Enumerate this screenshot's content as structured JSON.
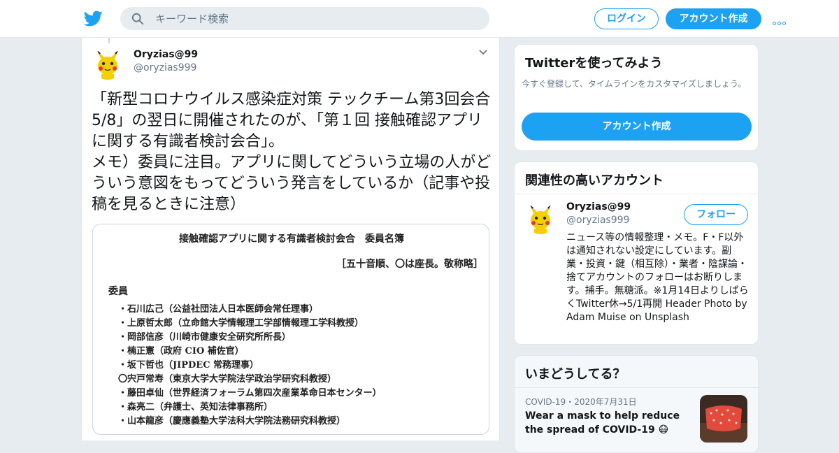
{
  "header": {
    "search_placeholder": "キーワード検索",
    "login_label": "ログイン",
    "signup_label": "アカウント作成",
    "brand_color": "#1da1f2"
  },
  "tweet": {
    "author_name": "Oryzias@99",
    "author_handle": "@oryzias999",
    "text": "「新型コロナウイルス感染症対策 テックチーム第3回会合5/8」の翌日に開催されたのが、「第１回 接触確認アプリに関する有識者検討会合」。\nメモ）委員に注目。アプリに関してどういう立場の人がどういう意図をもってどういう発言をしているか（記事や投稿を見るときに注意）",
    "image": {
      "title": "接触確認アプリに関する有識者検討会合　委員名簿",
      "note": "［五十音順、〇は座長。敬称略］",
      "heading": "委員",
      "members": [
        "・石川広己（公益社団法人日本医師会常任理事）",
        "・上原哲太郎（立命館大学情報理工学部情報理工学科教授）",
        "・岡部信彦（川崎市健康安全研究所所長）",
        "・楠正憲（政府 CIO 補佐官）",
        "・坂下哲也（JIPDEC 常務理事）",
        "〇宍戸常寿（東京大学大学院法学政治学研究科教授）",
        "・藤田卓仙（世界経済フォーラム第四次産業革命日本センター）",
        "・森亮二（弁護士、英知法律事務所）",
        "・山本龍彦（慶應義塾大学法科大学院法務研究科教授）"
      ]
    }
  },
  "sidebar": {
    "try_card": {
      "title": "Twitterを使ってみよう",
      "description": "今すぐ登録して、タイムラインをカスタマイズしましょう。",
      "button_label": "アカウント作成"
    },
    "related": {
      "title": "関連性の高いアカウント",
      "name": "Oryzias@99",
      "handle": "@oryzias999",
      "follow_label": "フォロー",
      "bio": "ニュース等の情報整理・メモ。F・F以外は通知されない設定にしています。副業・投資・鍵（相互除）・業者・陰謀論・捨てアカウントのフォローはお断りします。捕手。無糖派。※1月14日よりしばらくTwitter休→5/1再開 Header Photo by Adam Muise on Unsplash"
    },
    "trends": {
      "title": "いまどうしてる？",
      "meta": "COVID-19・2020年7月31日",
      "headline": "Wear a mask to help reduce the spread of COVID-19 😷"
    }
  }
}
